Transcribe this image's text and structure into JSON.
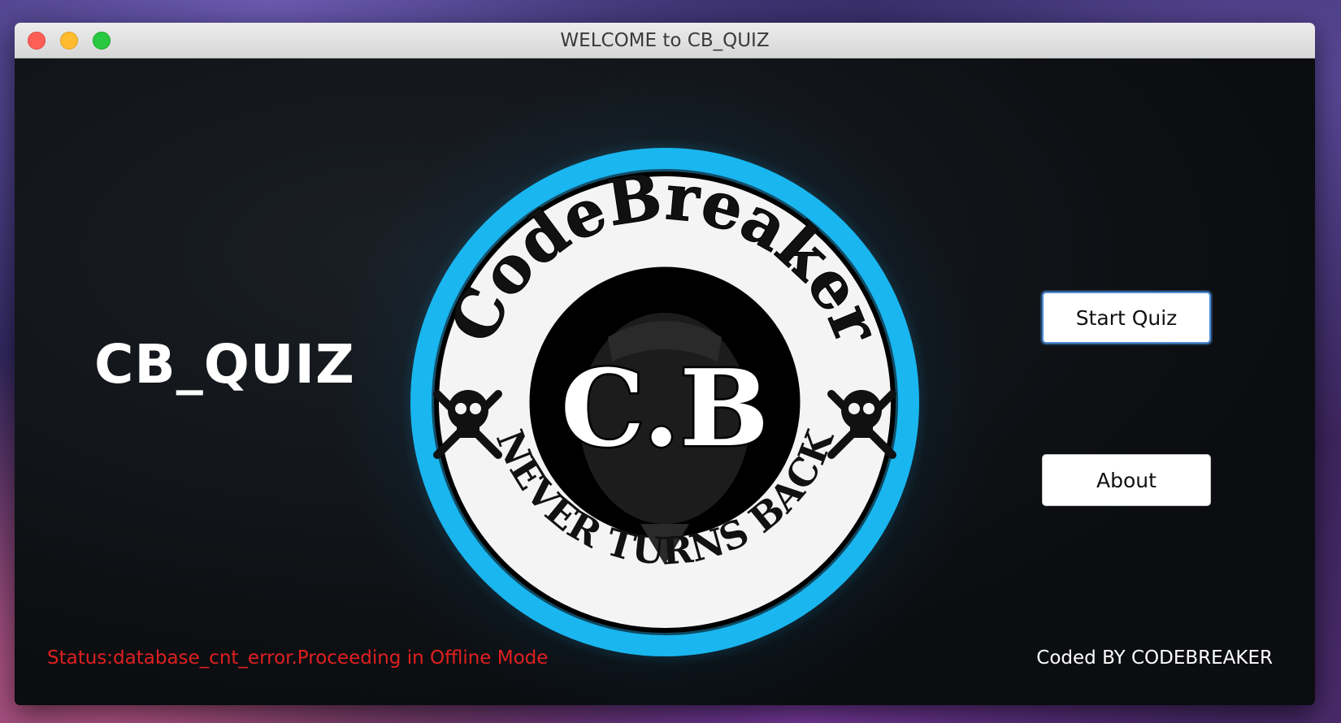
{
  "window": {
    "title": "WELCOME to CB_QUIZ"
  },
  "main": {
    "app_title": "CB_QUIZ",
    "logo": {
      "top_text": "CodeBreaker",
      "center_text": "C.B",
      "bottom_text": "NEVER TURNS BACK",
      "ring_color": "#19b6f0"
    },
    "buttons": {
      "start_quiz": "Start Quiz",
      "about": "About"
    },
    "status_text": "Status:database_cnt_error.Proceeding in Offline Mode",
    "status_color": "#e02020",
    "credit_text": "Coded BY CODEBREAKER"
  }
}
